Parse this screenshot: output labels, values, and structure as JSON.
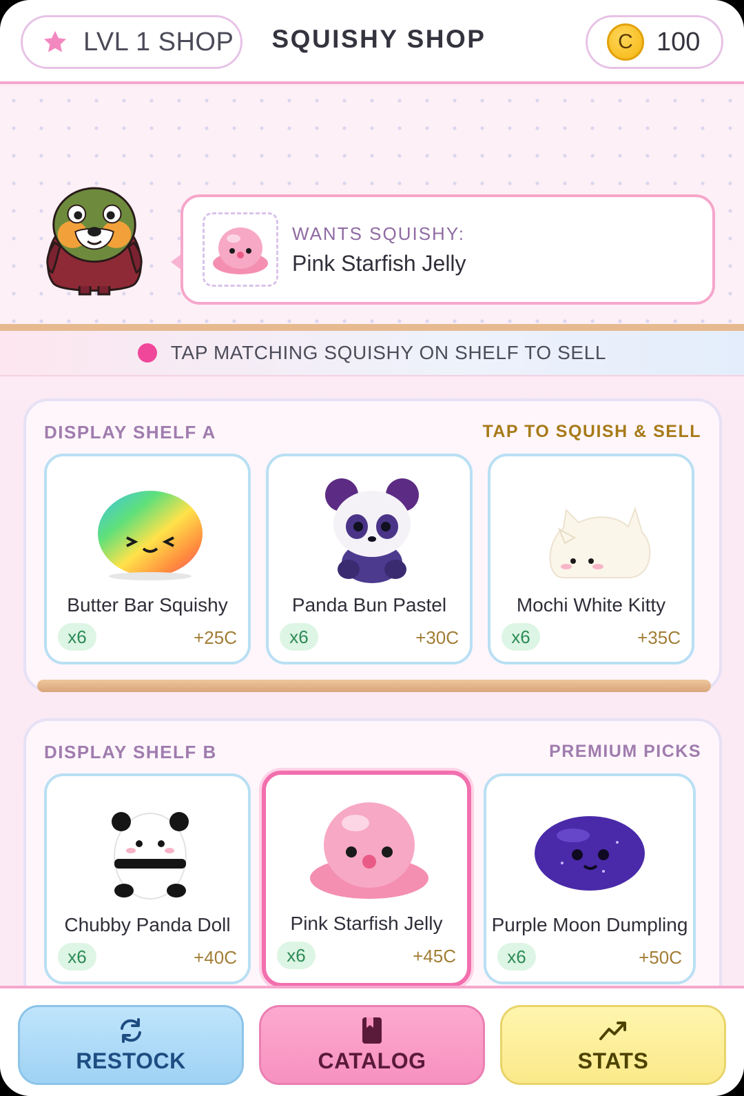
{
  "header": {
    "level_label": "LVL 1 SHOP",
    "title": "SQUISHY SHOP",
    "coin_symbol": "C",
    "coins": "100"
  },
  "customer": {
    "wants_label": "WANTS SQUISHY:",
    "wants_item": "Pink Starfish Jelly"
  },
  "hint": {
    "text": "TAP MATCHING SQUISHY ON SHELF TO SELL"
  },
  "shelves": [
    {
      "title": "DISPLAY SHELF A",
      "tag": "TAP TO SQUISH & SELL",
      "items": [
        {
          "name": "Butter Bar Squishy",
          "qty": "x6",
          "price": "+25C",
          "icon": "rainbow-bun-icon"
        },
        {
          "name": "Panda Bun Pastel",
          "qty": "x6",
          "price": "+30C",
          "icon": "galaxy-panda-icon"
        },
        {
          "name": "Mochi White Kitty",
          "qty": "x6",
          "price": "+35C",
          "icon": "white-kitty-icon"
        }
      ]
    },
    {
      "title": "DISPLAY SHELF B",
      "tag": "PREMIUM PICKS",
      "items": [
        {
          "name": "Chubby Panda Doll",
          "qty": "x6",
          "price": "+40C",
          "icon": "panda-doll-icon"
        },
        {
          "name": "Pink Starfish Jelly",
          "qty": "x6",
          "price": "+45C",
          "icon": "pink-jelly-icon",
          "selected": true
        },
        {
          "name": "Purple Moon Dumpling",
          "qty": "x6",
          "price": "+50C",
          "icon": "purple-dumpling-icon"
        }
      ]
    }
  ],
  "nav": {
    "restock": "RESTOCK",
    "catalog": "CATALOG",
    "stats": "STATS"
  },
  "colors": {
    "accent_pink": "#f26fae",
    "card_border": "#b9dff3",
    "price_gold": "#a17d35",
    "qty_green": "#2e8b57"
  }
}
